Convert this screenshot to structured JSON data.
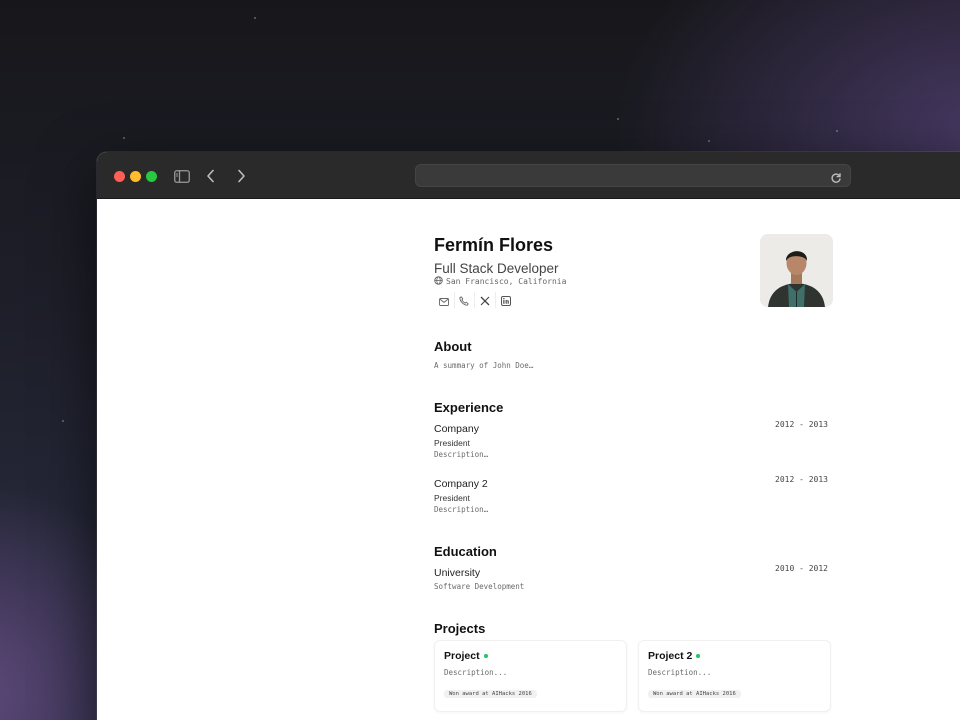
{
  "resume": {
    "name": "Fermín Flores",
    "title": "Full Stack Developer",
    "location": "San Francisco, California"
  },
  "contacts": [
    {
      "icon": "mail-icon"
    },
    {
      "icon": "phone-icon"
    },
    {
      "icon": "x-icon"
    },
    {
      "icon": "linkedin-icon"
    }
  ],
  "about": {
    "heading": "About",
    "summary": "A summary of John Doe…"
  },
  "experience": {
    "heading": "Experience",
    "items": [
      {
        "company": "Company",
        "position": "President",
        "description": "Description…",
        "dates": "2012 - 2013"
      },
      {
        "company": "Company 2",
        "position": "President",
        "description": "Description…",
        "dates": "2012 - 2013"
      }
    ]
  },
  "education": {
    "heading": "Education",
    "items": [
      {
        "school": "University",
        "degree": "Software Development",
        "dates": "2010 - 2012"
      }
    ]
  },
  "projects": {
    "heading": "Projects",
    "items": [
      {
        "title": "Project",
        "description": "Description...",
        "badge": "Won award at AIHacks 2016"
      },
      {
        "title": "Project 2",
        "description": "Description...",
        "badge": "Won award at AIHacks 2016"
      }
    ]
  },
  "colors": {
    "close": "#ff5f57",
    "minimize": "#febc2e",
    "maximize": "#28c840",
    "status_dot": "#22c55e"
  }
}
